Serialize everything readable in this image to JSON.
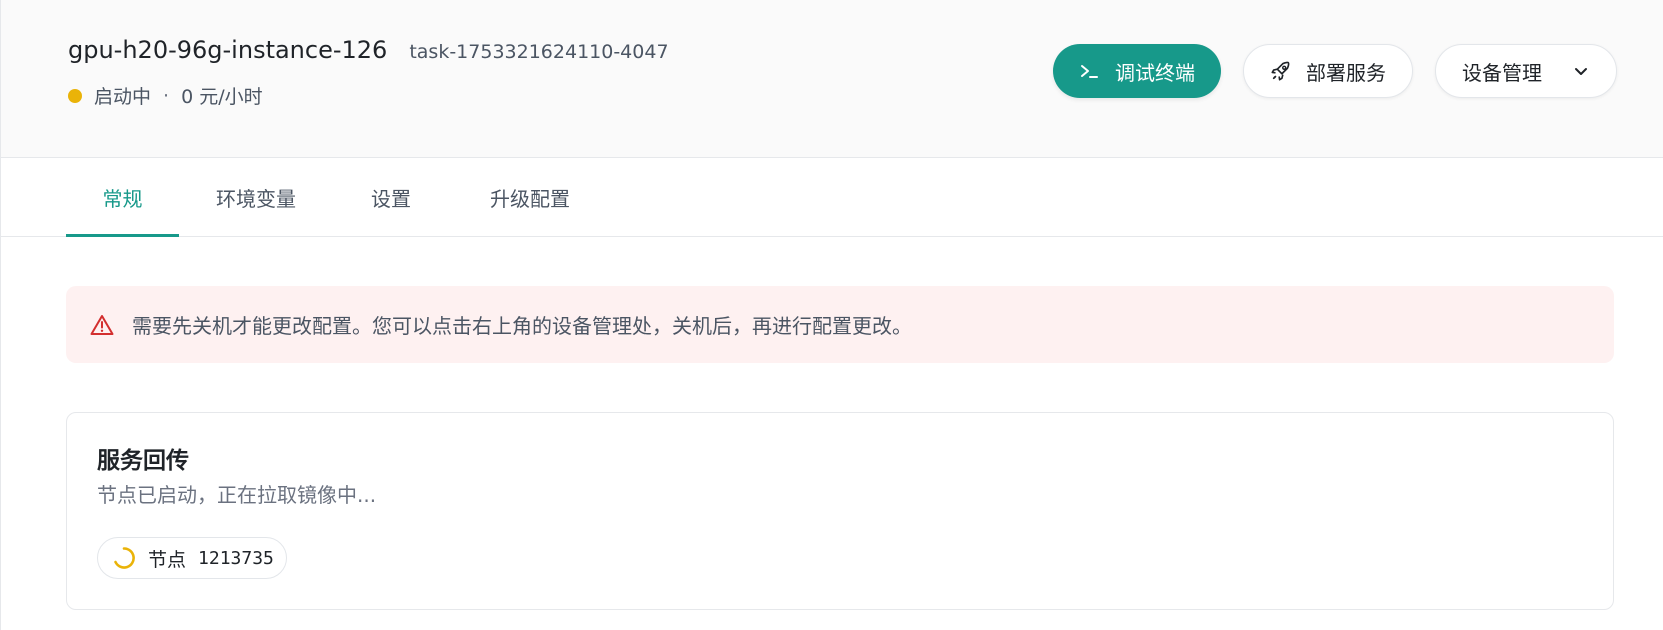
{
  "header": {
    "instance_name": "gpu-h20-96g-instance-126",
    "task_id": "task-1753321624110-4047",
    "status_text": "启动中",
    "separator": "·",
    "price_text": "0 元/小时",
    "status_color": "#eab308",
    "actions": {
      "terminal_label": "调试终端",
      "terminal_icon": "terminal-icon",
      "deploy_label": "部署服务",
      "deploy_icon": "rocket-icon",
      "device_label": "设备管理",
      "device_icon": "chevron-down-icon"
    }
  },
  "tabs": [
    {
      "label": "常规",
      "active": true
    },
    {
      "label": "环境变量",
      "active": false
    },
    {
      "label": "设置",
      "active": false
    },
    {
      "label": "升级配置",
      "active": false
    }
  ],
  "alert": {
    "icon": "warning-icon",
    "text": "需要先关机才能更改配置。您可以点击右上角的设备管理处，关机后，再进行配置更改。"
  },
  "card": {
    "title": "服务回传",
    "subtitle": "节点已启动，正在拉取镜像中...",
    "node": {
      "icon": "spinner-icon",
      "label": "节点",
      "id": "1213735"
    }
  },
  "colors": {
    "accent": "#17998a",
    "warning_bg": "#fef1f1",
    "warning_icon": "#d32f2f",
    "spinner": "#eab308"
  }
}
